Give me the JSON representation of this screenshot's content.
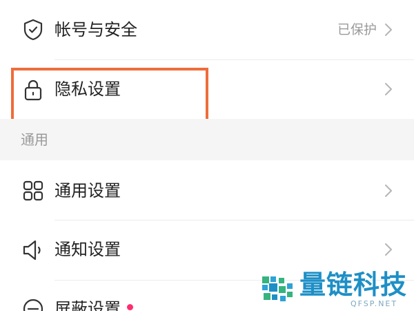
{
  "items": {
    "account_security": {
      "label": "帐号与安全",
      "value": "已保护",
      "icon": "shield-check-icon"
    },
    "privacy": {
      "label": "隐私设置",
      "icon": "lock-icon"
    },
    "general": {
      "label": "通用设置",
      "icon": "grid-icon"
    },
    "notifications": {
      "label": "通知设置",
      "icon": "speaker-icon"
    },
    "blocking": {
      "label": "屏蔽设置",
      "icon": "block-icon",
      "has_badge": true
    }
  },
  "sections": {
    "general_title": "通用"
  },
  "highlight": {
    "target": "privacy",
    "color": "#ee6d3c"
  },
  "watermark": {
    "brand": "量链科技",
    "domain": "QFSP.NET"
  },
  "colors": {
    "text_primary": "#222222",
    "text_secondary": "#9a9a9a",
    "section_bg": "#f5f5f5",
    "badge": "#ff2d6f",
    "brand": "#1e8fc6"
  }
}
